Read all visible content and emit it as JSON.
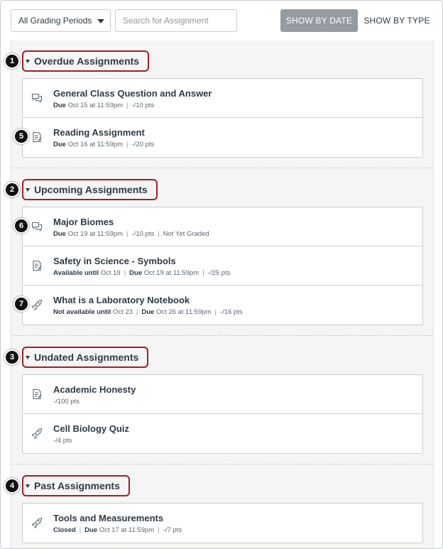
{
  "toolbar": {
    "grading_period": "All Grading Periods",
    "search_placeholder": "Search for Assignment",
    "show_by_date": "SHOW BY DATE",
    "show_by_type": "SHOW BY TYPE"
  },
  "sections": [
    {
      "title": "Overdue Assignments",
      "callout": "1",
      "items": [
        {
          "icon": "discussion-icon",
          "name": "General Class Question and Answer",
          "meta": [
            {
              "b": "Due",
              "t": " Oct 15 at 11:59pm"
            },
            {
              "t": "-/10 pts"
            }
          ],
          "callout": ""
        },
        {
          "icon": "assignment-icon",
          "name": "Reading Assignment",
          "meta": [
            {
              "b": "Due",
              "t": " Oct 16 at 11:59pm"
            },
            {
              "t": "-/20 pts"
            }
          ],
          "callout": "5"
        }
      ]
    },
    {
      "title": "Upcoming Assignments",
      "callout": "2",
      "items": [
        {
          "icon": "discussion-icon",
          "name": "Major Biomes",
          "meta": [
            {
              "b": "Due",
              "t": " Oct 19 at 11:59pm"
            },
            {
              "t": "-/10 pts"
            },
            {
              "t": "Not Yet Graded"
            }
          ],
          "callout": "6"
        },
        {
          "icon": "assignment-icon",
          "name": "Safety in Science - Symbols",
          "meta": [
            {
              "b": "Available until",
              "t": " Oct 19"
            },
            {
              "b": "Due",
              "t": " Oct 19 at 11:59pm"
            },
            {
              "t": "-/25 pts"
            }
          ],
          "callout": ""
        },
        {
          "icon": "quiz-icon",
          "name": "What is a Laboratory Notebook",
          "meta": [
            {
              "b": "Not available until",
              "t": " Oct 23"
            },
            {
              "b": "Due",
              "t": " Oct 26 at 11:59pm"
            },
            {
              "t": "-/16 pts"
            }
          ],
          "callout": "7"
        }
      ]
    },
    {
      "title": "Undated Assignments",
      "callout": "3",
      "items": [
        {
          "icon": "assignment-icon",
          "name": "Academic Honesty",
          "meta": [
            {
              "t": "-/100 pts"
            }
          ],
          "callout": ""
        },
        {
          "icon": "quiz-icon",
          "name": "Cell Biology Quiz",
          "meta": [
            {
              "t": "-/4 pts"
            }
          ],
          "callout": ""
        }
      ]
    },
    {
      "title": "Past Assignments",
      "callout": "4",
      "items": [
        {
          "icon": "quiz-icon",
          "name": "Tools and Measurements",
          "meta": [
            {
              "b": "Closed",
              "t": ""
            },
            {
              "b": "Due",
              "t": " Oct 17 at 11:59pm"
            },
            {
              "t": "-/7 pts"
            }
          ],
          "callout": ""
        }
      ]
    }
  ]
}
